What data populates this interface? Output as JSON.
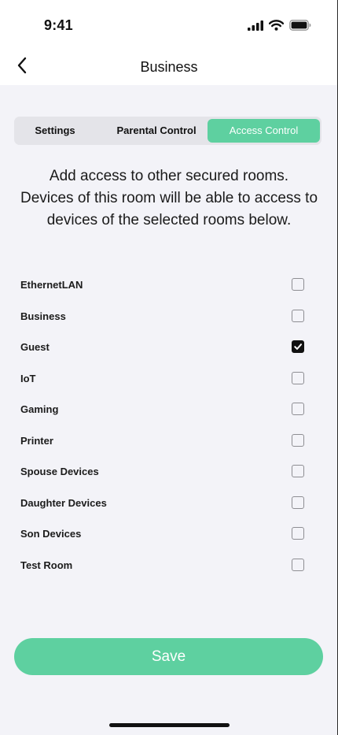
{
  "status_bar": {
    "time": "9:41",
    "icons": [
      "signal-icon",
      "wifi-icon",
      "battery-icon"
    ]
  },
  "nav": {
    "title": "Business",
    "back_icon": "chevron-left-icon"
  },
  "tabs": [
    {
      "label": "Settings",
      "selected": false
    },
    {
      "label": "Parental Control",
      "selected": false
    },
    {
      "label": "Access Control",
      "selected": true
    }
  ],
  "description": {
    "line1": "Add access to other secured rooms.",
    "line2": "Devices of this room will be able to access to",
    "line3": "devices of the selected rooms below."
  },
  "rooms": [
    {
      "label": "EthernetLAN",
      "checked": false
    },
    {
      "label": "Business",
      "checked": false
    },
    {
      "label": "Guest",
      "checked": true
    },
    {
      "label": "IoT",
      "checked": false
    },
    {
      "label": "Gaming",
      "checked": false
    },
    {
      "label": "Printer",
      "checked": false
    },
    {
      "label": "Spouse Devices",
      "checked": false
    },
    {
      "label": "Daughter Devices",
      "checked": false
    },
    {
      "label": "Son Devices",
      "checked": false
    },
    {
      "label": "Test Room",
      "checked": false
    }
  ],
  "save_button": {
    "label": "Save"
  },
  "colors": {
    "accent": "#5ed0a0",
    "background": "#f3f3f8",
    "header": "#ffffff"
  }
}
